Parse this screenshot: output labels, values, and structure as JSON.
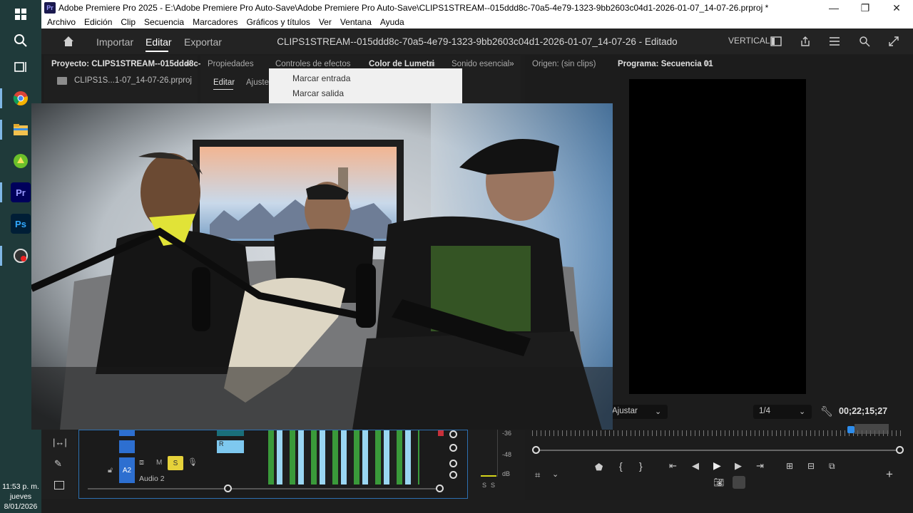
{
  "window": {
    "app_badge": "Pr",
    "title": "Adobe Premiere Pro 2025 - E:\\Adobe Premiere Pro Auto-Save\\Adobe Premiere Pro Auto-Save\\CLIPS1STREAM--015ddd8c-70a5-4e79-1323-9bb2603c04d1-2026-01-07_14-07-26.prproj *",
    "minimize": "—",
    "restore": "❐",
    "close": "✕"
  },
  "menubar": [
    "Archivo",
    "Edición",
    "Clip",
    "Secuencia",
    "Marcadores",
    "Gráficos y títulos",
    "Ver",
    "Ventana",
    "Ayuda"
  ],
  "header": {
    "tabs": [
      "Importar",
      "Editar",
      "Exportar"
    ],
    "active_tab": "Editar",
    "document_title": "CLIPS1STREAM--015ddd8c-70a5-4e79-1323-9bb2603c04d1-2026-01-07_14-07-26 - Editado",
    "layout_label": "VERTICAL"
  },
  "taskbar": {
    "premiere_label": "Pr",
    "photoshop_label": "Ps",
    "clock_time": "11:53 p. m.",
    "clock_day": "jueves",
    "clock_date": "8/01/2026"
  },
  "project_panel": {
    "tab": "Proyecto: CLIPS1STREAM--015ddd8c-70",
    "file": "CLIPS1S...1-07_14-07-26.prproj"
  },
  "effects_panel": {
    "tabs": [
      "Propiedades",
      "Controles de efectos",
      "Color de Lumetri",
      "Sonido esencial"
    ],
    "active_tab": "Color de Lumetri",
    "subtabs": [
      "Editar",
      "Ajustes"
    ],
    "context_menu": [
      "Marcar entrada",
      "Marcar salida"
    ]
  },
  "monitors": {
    "source_tab": "Origen: (sin clips)",
    "program_tab": "Programa: Secuencia 01",
    "fit_label": "Ajustar",
    "resolution": "1/4",
    "timecode": "00;22;15;27"
  },
  "timeline": {
    "track_a2": "A2",
    "track_name": "Audio 2",
    "mute": "M",
    "solo": "S",
    "clip_badge": "R",
    "meter_labels": [
      "-36",
      "-48",
      "dB"
    ],
    "meter_solo": [
      "S",
      "S"
    ]
  },
  "colors": {
    "accent_blue": "#2d8ceb",
    "solo_yellow": "#e6d23a",
    "clip_audio_green": "#3f8a3f",
    "clip_cyan": "#3aa7c9"
  }
}
